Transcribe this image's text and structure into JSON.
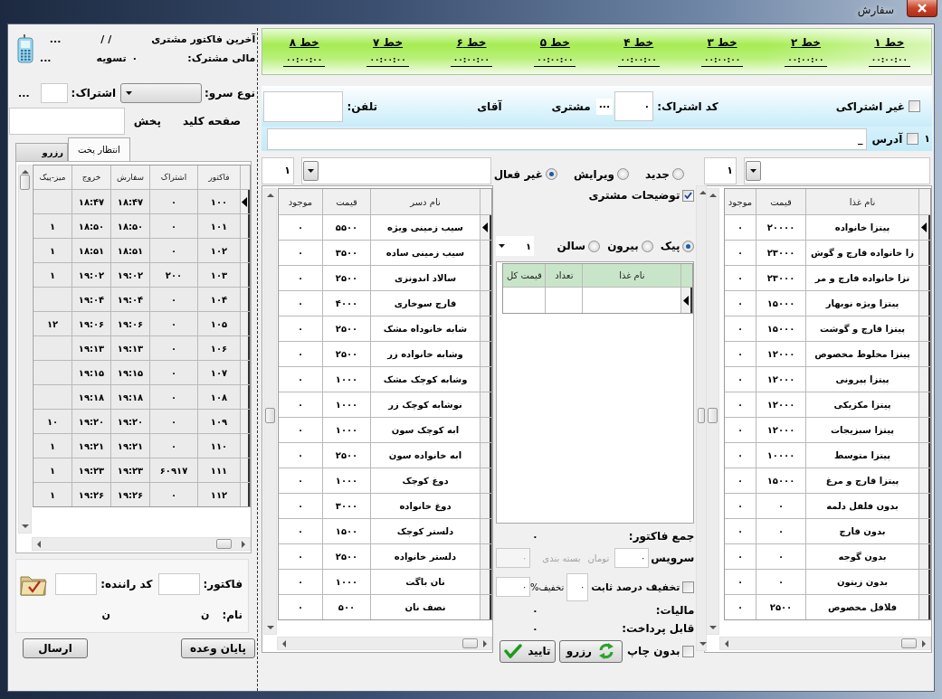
{
  "window": {
    "title": "سفارش"
  },
  "lines": [
    {
      "label": "خط ۱",
      "time": "۰۰:۰۰:۰۰"
    },
    {
      "label": "خط ۲",
      "time": "۰۰:۰۰:۰۰"
    },
    {
      "label": "خط ۳",
      "time": "۰۰:۰۰:۰۰"
    },
    {
      "label": "خط ۴",
      "time": "۰۰:۰۰:۰۰"
    },
    {
      "label": "خط ۵",
      "time": "۰۰:۰۰:۰۰"
    },
    {
      "label": "خط ۶",
      "time": "۰۰:۰۰:۰۰"
    },
    {
      "label": "خط ۷",
      "time": "۰۰:۰۰:۰۰"
    },
    {
      "label": "خط ۸",
      "time": "۰۰:۰۰:۰۰"
    }
  ],
  "customer": {
    "non_subscriber": {
      "label": "غیر اشتراکی",
      "checked": false
    },
    "code_label": "کد اشتراک:",
    "code_value": "۰",
    "browse": "...",
    "customer_label": "مشتری",
    "title_label": "آقای",
    "phone_label": "تلفن:"
  },
  "address": {
    "index": "۱",
    "checked": false,
    "label": "آدرس",
    "value": "_"
  },
  "left_panel": {
    "last_invoice": {
      "label": "آخرین فاکتور مشتری",
      "date": "/ /",
      "more": "..."
    },
    "balance": {
      "label": "مالی مشترک:",
      "value": "۰",
      "status": "تسویه",
      "more": "..."
    },
    "serve_type": {
      "label": "نوع سرو:"
    },
    "subscription": {
      "label": "اشتراک:",
      "browse": "..."
    },
    "keyboard": {
      "label": "صفحه کلید"
    },
    "dispatch": {
      "label": "پخش"
    },
    "tabs": [
      {
        "label": "انتظار پخت",
        "selected": true
      },
      {
        "label": "رزرو",
        "selected": false
      }
    ],
    "orders": {
      "columns": [
        "فاکتور",
        "اشتراک",
        "سفارش",
        "خروج",
        "میز-پیک"
      ],
      "rows": [
        {
          "selected": true,
          "invoice": "۱۰۰",
          "subscription": "۰",
          "ordered": "۱۸:۴۷",
          "out": "۱۸:۴۷"
        },
        {
          "selected": false,
          "invoice": "۱۰۱",
          "subscription": "۰",
          "ordered": "۱۸:۵۰",
          "out": "۱۸:۵۰",
          "table": "۱"
        },
        {
          "selected": false,
          "invoice": "۱۰۲",
          "subscription": "۰",
          "ordered": "۱۸:۵۱",
          "out": "۱۸:۵۱",
          "table": "۱"
        },
        {
          "selected": false,
          "invoice": "۱۰۳",
          "subscription": "۲۰۰",
          "ordered": "۱۹:۰۲",
          "out": "۱۹:۰۲",
          "table": "۱"
        },
        {
          "selected": false,
          "invoice": "۱۰۴",
          "subscription": "۰",
          "ordered": "۱۹:۰۴",
          "out": "۱۹:۰۴"
        },
        {
          "selected": false,
          "invoice": "۱۰۵",
          "subscription": "۰",
          "ordered": "۱۹:۰۶",
          "out": "۱۹:۰۶",
          "table": "۱۲"
        },
        {
          "selected": false,
          "invoice": "۱۰۶",
          "subscription": "۰",
          "ordered": "۱۹:۱۳",
          "out": "۱۹:۱۳"
        },
        {
          "selected": false,
          "invoice": "۱۰۷",
          "subscription": "۰",
          "ordered": "۱۹:۱۵",
          "out": "۱۹:۱۵"
        },
        {
          "selected": false,
          "invoice": "۱۰۸",
          "subscription": "۰",
          "ordered": "۱۹:۱۸",
          "out": "۱۹:۱۸"
        },
        {
          "selected": false,
          "invoice": "۱۰۹",
          "subscription": "۰",
          "ordered": "۱۹:۲۰",
          "out": "۱۹:۲۰",
          "table": "۱۰"
        },
        {
          "selected": false,
          "invoice": "۱۱۰",
          "subscription": "۰",
          "ordered": "۱۹:۲۱",
          "out": "۱۹:۲۱",
          "table": "۱"
        },
        {
          "selected": false,
          "invoice": "۱۱۱",
          "subscription": "۶۰۹۱۷",
          "ordered": "۱۹:۲۳",
          "out": "۱۹:۲۳",
          "table": "۱"
        },
        {
          "selected": false,
          "invoice": "۱۱۲",
          "subscription": "۰",
          "ordered": "۱۹:۲۶",
          "out": "۱۹:۲۶",
          "table": "۱"
        }
      ]
    },
    "invoice_label": "فاکتور:",
    "driver_label": "کد راننده:",
    "name_label": "نام:",
    "name_values": [
      "ن",
      "ن"
    ],
    "buttons": [
      {
        "label": "پایان وعده"
      },
      {
        "label": "ارسال"
      }
    ]
  },
  "sides": {
    "count": "۱",
    "columns": [
      "نام دسر",
      "قیمت",
      "موجود"
    ],
    "rows": [
      {
        "selected": true,
        "name": "سیب زمینی ویژه",
        "price": "۵۵۰۰",
        "stock": "۰"
      },
      {
        "selected": false,
        "name": "سیب زمینی ساده",
        "price": "۳۵۰۰",
        "stock": "۰"
      },
      {
        "selected": false,
        "name": "سالاد اندونزی",
        "price": "۲۵۰۰",
        "stock": "۰"
      },
      {
        "selected": false,
        "name": "قارچ سوخاری",
        "price": "۴۰۰۰",
        "stock": "۰"
      },
      {
        "selected": false,
        "name": "شابه خانوداه مشک",
        "price": "۲۵۰۰",
        "stock": "۰"
      },
      {
        "selected": false,
        "name": "وشابه خانواده زر",
        "price": "۲۵۰۰",
        "stock": "۰"
      },
      {
        "selected": false,
        "name": "وشابه کوچک مشک",
        "price": "۱۰۰۰",
        "stock": "۰"
      },
      {
        "selected": false,
        "name": "نوشابه کوچک زر",
        "price": "۱۰۰۰",
        "stock": "۰"
      },
      {
        "selected": false,
        "name": "ابه کوچک سون",
        "price": "۱۰۰۰",
        "stock": "۰"
      },
      {
        "selected": false,
        "name": "ابه خانواده سون",
        "price": "۲۵۰۰",
        "stock": "۰"
      },
      {
        "selected": false,
        "name": "دوغ کوچک",
        "price": "۱۰۰۰",
        "stock": "۰"
      },
      {
        "selected": false,
        "name": "دوغ خانواده",
        "price": "۳۰۰۰",
        "stock": "۰"
      },
      {
        "selected": false,
        "name": "دلستر کوچک",
        "price": "۱۵۰۰",
        "stock": "۰"
      },
      {
        "selected": false,
        "name": "دلستر خانواده",
        "price": "۲۵۰۰",
        "stock": "۰"
      },
      {
        "selected": false,
        "name": "نان باگت",
        "price": "۱۰۰۰",
        "stock": "۰"
      },
      {
        "selected": false,
        "name": "نصف نان",
        "price": "۵۰۰",
        "stock": "۰"
      }
    ]
  },
  "order": {
    "modes": [
      {
        "label": "جدید",
        "selected": false
      },
      {
        "label": "ویرایش",
        "selected": false
      },
      {
        "label": "غیر فعال",
        "selected": true
      }
    ],
    "notes": {
      "label": "توضیحات مشتری",
      "checked": true
    },
    "service_types": [
      {
        "label": "پیک",
        "selected": true
      },
      {
        "label": "بیرون",
        "selected": false
      },
      {
        "label": "سالن",
        "selected": false
      }
    ],
    "service_count": "۱",
    "items": {
      "columns": [
        "نام غذا",
        "تعداد",
        "قیمت کل"
      ],
      "rows": [
        {
          "selected": true
        }
      ]
    },
    "total": {
      "label": "جمع فاکتور:",
      "value": "۰"
    },
    "service_fee": {
      "label": "سرویس",
      "value": "۰",
      "unit": "تومان"
    },
    "packaging": {
      "label": "بسته بندی",
      "value": "۰",
      "disabled": true
    },
    "fixed_discount": {
      "label": "تخفیف درصد ثابت",
      "checked": false,
      "value": "۰"
    },
    "discount": {
      "label": "تخفیف%",
      "value": "۰"
    },
    "tax": {
      "label": "مالیات:",
      "value": "۰"
    },
    "payable": {
      "label": "قابل پرداخت:",
      "value": "۰"
    },
    "no_print": {
      "label": "بدون چاپ",
      "checked": false
    },
    "buttons": [
      {
        "kind": "reserve",
        "label": "رزرو"
      },
      {
        "kind": "confirm",
        "label": "تایید"
      }
    ]
  },
  "foods": {
    "count": "۱",
    "columns": [
      "نام غذا",
      "قیمت",
      "موجود"
    ],
    "rows": [
      {
        "selected": true,
        "name": "پیتزا خانواده",
        "price": "۲۰۰۰۰",
        "stock": "۰"
      },
      {
        "selected": false,
        "name": "زا خانواده قارچ و گوش",
        "price": "۲۳۰۰۰",
        "stock": "۰"
      },
      {
        "selected": false,
        "name": "تزا خانواده قارچ و مر",
        "price": "۲۳۰۰۰",
        "stock": "۰"
      },
      {
        "selected": false,
        "name": "پیتزا ویژه نوبهار",
        "price": "۱۵۰۰۰",
        "stock": "۰"
      },
      {
        "selected": false,
        "name": "پیتزا قارچ و گوشت",
        "price": "۱۵۰۰۰",
        "stock": "۰"
      },
      {
        "selected": false,
        "name": "پیتزا مخلوط مخصوص",
        "price": "۱۲۰۰۰",
        "stock": "۰"
      },
      {
        "selected": false,
        "name": "پیتزا پپرونی",
        "price": "۱۲۰۰۰",
        "stock": "۰"
      },
      {
        "selected": false,
        "name": "پیتزا مکزیکی",
        "price": "۱۲۰۰۰",
        "stock": "۰"
      },
      {
        "selected": false,
        "name": "پیتزا سبزیجات",
        "price": "۱۲۰۰۰",
        "stock": "۰"
      },
      {
        "selected": false,
        "name": "پیتزا متوسط",
        "price": "۱۰۰۰۰",
        "stock": "۰"
      },
      {
        "selected": false,
        "name": "پیتزا قارچ و مرغ",
        "price": "۱۵۰۰۰",
        "stock": "۰"
      },
      {
        "selected": false,
        "name": "بدون فلفل دلمه",
        "price": "۰",
        "stock": "۰"
      },
      {
        "selected": false,
        "name": "بدون قارچ",
        "price": "۰",
        "stock": "۰"
      },
      {
        "selected": false,
        "name": "بدون گوجه",
        "price": "۰",
        "stock": "۰"
      },
      {
        "selected": false,
        "name": "بدون زیتون",
        "price": "۰",
        "stock": "۰"
      },
      {
        "selected": false,
        "name": "فلافل مخصوص",
        "price": "۲۵۰۰",
        "stock": "۰"
      }
    ]
  }
}
